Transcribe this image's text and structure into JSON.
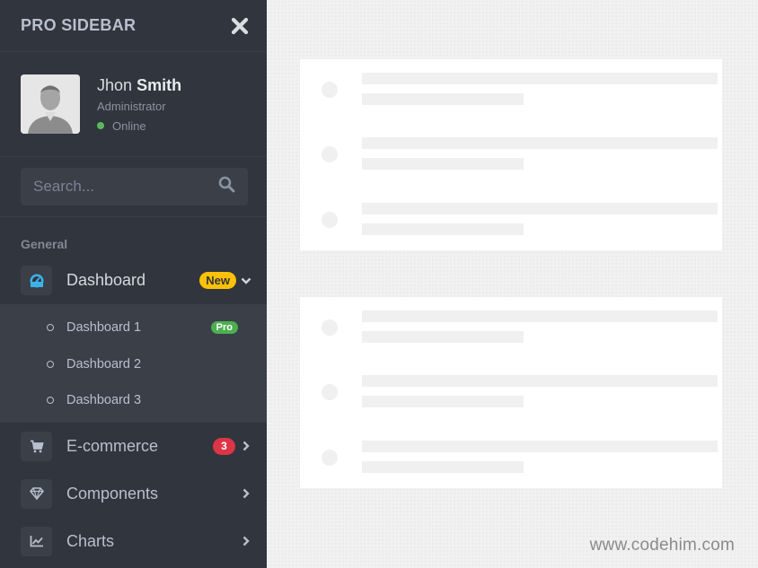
{
  "sidebar": {
    "brand": "PRO SIDEBAR",
    "user": {
      "first_name": "Jhon",
      "last_name": "Smith",
      "role": "Administrator",
      "status": "Online"
    },
    "search": {
      "placeholder": "Search..."
    },
    "section_header": "General",
    "menu": [
      {
        "label": "Dashboard",
        "icon": "dashboard-icon",
        "badge": "New"
      },
      {
        "label": "E-commerce",
        "icon": "shopping-cart-icon",
        "badge": "3"
      },
      {
        "label": "Components",
        "icon": "gem-icon"
      },
      {
        "label": "Charts",
        "icon": "chart-line-icon"
      }
    ],
    "submenu": [
      {
        "label": "Dashboard 1",
        "badge": "Pro"
      },
      {
        "label": "Dashboard 2"
      },
      {
        "label": "Dashboard 3"
      }
    ]
  },
  "watermark": "www.codehim.com",
  "colors": {
    "sidebar_bg": "#31353d",
    "submenu_bg": "#3a3f48",
    "badge_new": "#ffc107",
    "badge_count": "#dc3545",
    "badge_pro": "#4caf50",
    "online": "#5cb85c",
    "dashboard_icon": "#3bb3e9"
  }
}
